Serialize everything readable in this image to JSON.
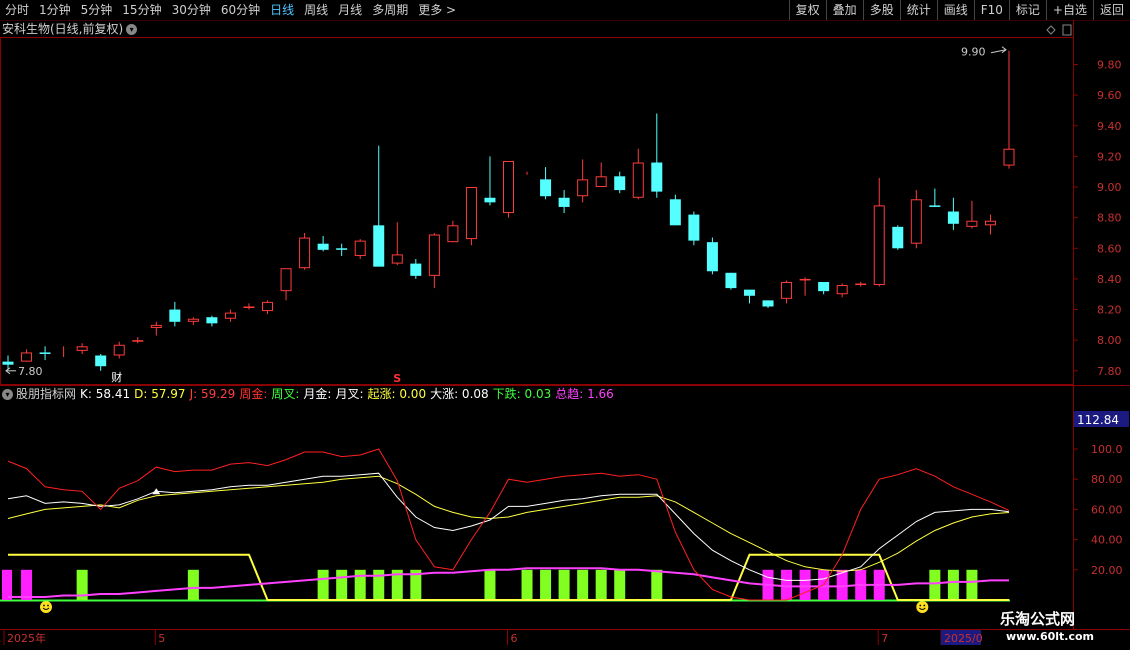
{
  "toolbar": {
    "periods": [
      "分时",
      "1分钟",
      "5分钟",
      "15分钟",
      "30分钟",
      "60分钟",
      "日线",
      "周线",
      "月线",
      "多周期",
      "更多 >"
    ],
    "active_period": "日线",
    "right_buttons": [
      "复权",
      "叠加",
      "多股",
      "统计",
      "画线",
      "F10",
      "标记",
      "+自选",
      "返回"
    ]
  },
  "main_chart": {
    "title": "安科生物(日线,前复权)",
    "high_label": "9.90",
    "low_label": "7.80",
    "price_axis": [
      "9.80",
      "9.60",
      "9.40",
      "9.20",
      "9.00",
      "8.80",
      "8.60",
      "8.40",
      "8.20",
      "8.00",
      "7.80"
    ],
    "marker_cai": "财",
    "marker_s": "S",
    "colors": {
      "up": "#ff3c3c",
      "down": "#54ffff",
      "grid": "#8b0000"
    }
  },
  "indicator": {
    "name": "股朋指标网",
    "items": [
      {
        "text": "K: 58.41",
        "color": "#ffffff"
      },
      {
        "text": "D: 57.97",
        "color": "#ffff40"
      },
      {
        "text": "J: 59.29",
        "color": "#ff4040"
      },
      {
        "text": "周金:",
        "color": "#ff3030"
      },
      {
        "text": "周叉:",
        "color": "#40ff40"
      },
      {
        "text": "月金:",
        "color": "#ffffff"
      },
      {
        "text": "月叉:",
        "color": "#ffffff"
      },
      {
        "text": "起涨: 0.00",
        "color": "#ffff40"
      },
      {
        "text": "大涨: 0.08",
        "color": "#ffffff"
      },
      {
        "text": "下跌: 0.03",
        "color": "#40ff40"
      },
      {
        "text": "总趋: 1.66",
        "color": "#ff40ff"
      }
    ],
    "axis": [
      "100.0",
      "80.00",
      "60.00",
      "40.00",
      "20.00"
    ],
    "current_value": "112.84"
  },
  "x_axis": {
    "labels": [
      {
        "text": "2025年",
        "pos": "start"
      },
      {
        "text": "5",
        "pos": "may"
      },
      {
        "text": "6",
        "pos": "jun"
      },
      {
        "text": "7",
        "pos": "jul"
      },
      {
        "text": "2025/0",
        "pos": "end"
      }
    ]
  },
  "watermark": {
    "title": "乐淘公式网",
    "url": "www.60lt.com"
  },
  "chart_data": {
    "type": "candlestick",
    "symbol": "安科生物",
    "period": "日线",
    "ohlc": [
      [
        7.86,
        7.9,
        7.81,
        7.84
      ],
      [
        7.86,
        7.94,
        7.86,
        7.92
      ],
      [
        7.92,
        7.96,
        7.87,
        7.91
      ],
      [
        7.92,
        7.96,
        7.89,
        7.92
      ],
      [
        7.93,
        7.98,
        7.91,
        7.96
      ],
      [
        7.9,
        7.91,
        7.8,
        7.83
      ],
      [
        7.9,
        7.99,
        7.88,
        7.97
      ],
      [
        7.99,
        8.02,
        7.98,
        8.0
      ],
      [
        8.08,
        8.12,
        8.03,
        8.1
      ],
      [
        8.2,
        8.25,
        8.09,
        8.12
      ],
      [
        8.12,
        8.15,
        8.1,
        8.14
      ],
      [
        8.15,
        8.16,
        8.09,
        8.11
      ],
      [
        8.14,
        8.2,
        8.12,
        8.18
      ],
      [
        8.21,
        8.24,
        8.2,
        8.22
      ],
      [
        8.19,
        8.26,
        8.17,
        8.25
      ],
      [
        8.32,
        8.44,
        8.26,
        8.47
      ],
      [
        8.47,
        8.7,
        8.46,
        8.67
      ],
      [
        8.63,
        8.68,
        8.58,
        8.59
      ],
      [
        8.6,
        8.63,
        8.55,
        8.59
      ],
      [
        8.55,
        8.66,
        8.53,
        8.65
      ],
      [
        8.75,
        9.27,
        8.48,
        8.48
      ],
      [
        8.5,
        8.77,
        8.49,
        8.56
      ],
      [
        8.5,
        8.53,
        8.4,
        8.42
      ],
      [
        8.42,
        8.7,
        8.34,
        8.69
      ],
      [
        8.64,
        8.78,
        8.64,
        8.75
      ],
      [
        8.66,
        9.0,
        8.62,
        9.0
      ],
      [
        8.93,
        9.2,
        8.88,
        8.9
      ],
      [
        8.83,
        9.17,
        8.8,
        9.17
      ],
      [
        9.1,
        9.1,
        9.08,
        9.1
      ],
      [
        9.05,
        9.13,
        8.92,
        8.94
      ],
      [
        8.93,
        8.98,
        8.83,
        8.87
      ],
      [
        8.94,
        9.18,
        8.9,
        9.05
      ],
      [
        9.0,
        9.16,
        9.0,
        9.07
      ],
      [
        9.07,
        9.1,
        8.96,
        8.98
      ],
      [
        8.93,
        9.25,
        8.92,
        9.16
      ],
      [
        9.16,
        9.48,
        8.93,
        8.97
      ],
      [
        8.92,
        8.95,
        8.75,
        8.75
      ],
      [
        8.82,
        8.84,
        8.62,
        8.65
      ],
      [
        8.64,
        8.67,
        8.43,
        8.45
      ],
      [
        8.44,
        8.44,
        8.33,
        8.34
      ],
      [
        8.33,
        8.32,
        8.24,
        8.29
      ],
      [
        8.26,
        8.26,
        8.21,
        8.22
      ],
      [
        8.27,
        8.39,
        8.24,
        8.38
      ],
      [
        8.39,
        8.41,
        8.29,
        8.4
      ],
      [
        8.38,
        8.38,
        8.3,
        8.32
      ],
      [
        8.3,
        8.37,
        8.28,
        8.36
      ],
      [
        8.36,
        8.38,
        8.35,
        8.37
      ],
      [
        8.36,
        9.06,
        8.35,
        8.88
      ],
      [
        8.74,
        8.75,
        8.59,
        8.6
      ],
      [
        8.63,
        8.98,
        8.6,
        8.92
      ],
      [
        8.88,
        8.99,
        8.87,
        8.87
      ],
      [
        8.84,
        8.93,
        8.72,
        8.76
      ],
      [
        8.74,
        8.91,
        8.73,
        8.78
      ],
      [
        8.75,
        8.82,
        8.69,
        8.78
      ],
      [
        9.14,
        9.89,
        9.12,
        9.25
      ]
    ],
    "indicator": {
      "K": [
        67,
        69,
        64,
        65,
        64,
        62,
        63,
        67,
        72,
        71,
        72,
        73,
        75,
        76,
        76,
        78,
        80,
        82,
        82,
        83,
        84,
        68,
        55,
        48,
        46,
        49,
        53,
        62,
        62,
        64,
        66,
        67,
        69,
        70,
        70,
        70,
        57,
        44,
        33,
        26,
        20,
        15,
        13,
        13,
        14,
        18,
        22,
        34,
        43,
        52,
        58,
        59,
        60,
        60,
        58.41
      ],
      "D": [
        54,
        57,
        60,
        61,
        62,
        63,
        61,
        66,
        69,
        70,
        71,
        72,
        73,
        74,
        75,
        76,
        77,
        78,
        80,
        81,
        82,
        77,
        70,
        62,
        58,
        55,
        54,
        55,
        58,
        60,
        62,
        64,
        66,
        68,
        68,
        69,
        65,
        58,
        51,
        44,
        38,
        32,
        26,
        22,
        20,
        19,
        20,
        25,
        31,
        39,
        46,
        51,
        55,
        57,
        57.97
      ],
      "J": [
        92,
        87,
        75,
        73,
        72,
        60,
        74,
        79,
        88,
        85,
        86,
        86,
        90,
        91,
        89,
        93,
        98,
        98,
        95,
        96,
        100,
        79,
        40,
        22,
        20,
        40,
        58,
        80,
        78,
        80,
        82,
        83,
        84,
        82,
        83,
        80,
        45,
        20,
        7,
        2,
        0,
        0,
        0,
        5,
        10,
        30,
        60,
        80,
        83,
        87,
        82,
        75,
        70,
        65,
        59.29
      ],
      "trend": [
        2,
        2,
        2,
        3,
        3,
        4,
        4,
        5,
        6,
        7,
        8,
        8,
        9,
        10,
        11,
        12,
        13,
        14,
        15,
        16,
        16,
        17,
        17,
        18,
        18,
        19,
        20,
        20,
        21,
        21,
        21,
        21,
        21,
        20,
        20,
        19,
        18,
        17,
        15,
        13,
        11,
        10,
        9,
        9,
        9,
        9,
        10,
        10,
        10,
        11,
        11,
        12,
        12,
        13,
        13
      ],
      "yellow_band": [
        30,
        30,
        30,
        30,
        30,
        30,
        30,
        30,
        30,
        30,
        30,
        30,
        30,
        30,
        0,
        0,
        0,
        0,
        0,
        0,
        0,
        0,
        0,
        0,
        0,
        0,
        0,
        0,
        0,
        0,
        0,
        0,
        0,
        0,
        0,
        0,
        0,
        0,
        0,
        0,
        30,
        30,
        30,
        30,
        30,
        30,
        30,
        30,
        0,
        0,
        0,
        0,
        0,
        0,
        0
      ],
      "magenta_bars": [
        0,
        1,
        0,
        0,
        0,
        0,
        0,
        0,
        0,
        0,
        0,
        0,
        0,
        0,
        0,
        0,
        0,
        0,
        0,
        0,
        0,
        0,
        0,
        0,
        0,
        0,
        0,
        0,
        0,
        0,
        0,
        0,
        0,
        0,
        0,
        0,
        0,
        0,
        0,
        0,
        0,
        1,
        1,
        1,
        1,
        1,
        1,
        1,
        0,
        0,
        0,
        0,
        0,
        0,
        0
      ],
      "green_bars": [
        0,
        0,
        0,
        0,
        1,
        0,
        0,
        0,
        0,
        0,
        1,
        0,
        0,
        0,
        0,
        0,
        0,
        1,
        1,
        1,
        1,
        1,
        1,
        0,
        0,
        0,
        1,
        0,
        1,
        1,
        1,
        1,
        1,
        1,
        0,
        1,
        0,
        0,
        0,
        0,
        0,
        0,
        0,
        0,
        0,
        0,
        0,
        0,
        0,
        0,
        1,
        1,
        1,
        0,
        0
      ]
    }
  }
}
